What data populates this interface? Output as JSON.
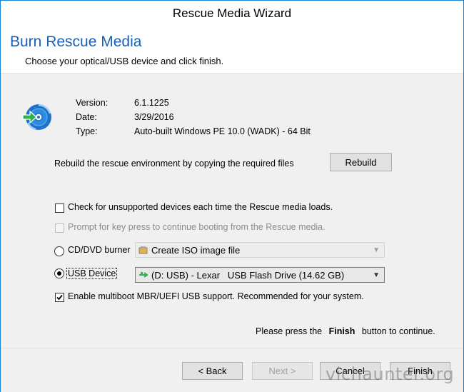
{
  "window": {
    "title": "Rescue Media Wizard"
  },
  "header": {
    "title": "Burn Rescue Media",
    "subtitle": "Choose your optical/USB device and click finish."
  },
  "info": {
    "version_label": "Version:",
    "version_value": "6.1.1225",
    "date_label": "Date:",
    "date_value": "3/29/2016",
    "type_label": "Type:",
    "type_value": "Auto-built Windows PE 10.0 (WADK) - 64 Bit"
  },
  "rebuild": {
    "text": "Rebuild the rescue environment by copying the required files",
    "button": "Rebuild"
  },
  "options": {
    "check_unsupported": {
      "label": "Check for unsupported devices each time the Rescue media loads.",
      "checked": false
    },
    "prompt_key": {
      "label": "Prompt for key press to continue booting from the Rescue media.",
      "checked": false,
      "disabled": true
    },
    "cd_radio": {
      "label": "CD/DVD burner",
      "selected": false
    },
    "cd_combo": {
      "value": "Create ISO image file",
      "disabled": true
    },
    "usb_radio": {
      "label": "USB Device",
      "selected": true
    },
    "usb_combo": {
      "value": "(D: USB) - Lexar   USB Flash Drive (14.62 GB)"
    },
    "multiboot": {
      "label": "Enable multiboot MBR/UEFI USB support. Recommended for your system.",
      "checked": true
    }
  },
  "instruction": {
    "before": "Please press the",
    "bold": "Finish",
    "after": "button to continue."
  },
  "footer": {
    "back": "< Back",
    "next": "Next >",
    "cancel": "Cancel",
    "finish": "Finish"
  },
  "watermark": "vichaunter.org",
  "icons": {
    "rescue": "disc-arrow-icon",
    "iso": "iso-file-icon",
    "usb": "usb-icon"
  },
  "colors": {
    "accent": "#1a61b5",
    "border": "#1883d7",
    "arrow": "#2db34a"
  }
}
